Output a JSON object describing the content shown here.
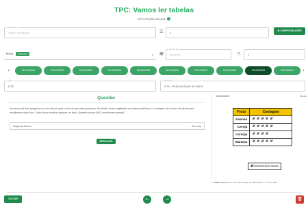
{
  "header": {
    "title": "TPC: Vamos ler tabelas",
    "subheading": "DESCRIÇÃO ALUNA",
    "help_icon": "question-circle-icon"
  },
  "form": {
    "topic_field": {
      "label": "Tópico(s) *",
      "placeholder": "Tópico de tabelas"
    },
    "order_field": {
      "label": "",
      "value": "1"
    },
    "config_button_label": "CONFIGURAÇÕES",
    "tipo_label": "Tema",
    "tipo_tag": "ENTRADA",
    "time_field": {
      "label": "Tempo (s)",
      "value": "00:00:10"
    },
    "sort_field": {
      "label": "",
      "value": "1"
    },
    "code_field": {
      "label": "Cód *",
      "value": "QTE"
    },
    "desc_field": {
      "label": "Descrição",
      "value": "QTE - Representação de dados"
    }
  },
  "pills": [
    {
      "label": "9101000001"
    },
    {
      "label": "9101000002"
    },
    {
      "label": "9101000003"
    },
    {
      "label": "9101000004"
    },
    {
      "label": "9101000005"
    },
    {
      "label": "9101000006"
    },
    {
      "label": "9101000007"
    },
    {
      "label": "9101000008"
    },
    {
      "label": "9101000009"
    },
    {
      "label": "9101000010"
    }
  ],
  "question": {
    "title": "Questão",
    "text": "Na escola da Ana, perguntou-se aos alunos qual o fruto de que mais gostavam. Na tabela, foram registadas as frutas escolhidas e a contagem do número de alunos que escolheram cada fruto. Cada aluno escolheu apenas um fruto. Quantos alunos NÃO escolheram ananás?",
    "answer_type": "Resposta Aberta",
    "answer_right": "Ad.-resp",
    "resolve_label": "RESOLVER"
  },
  "resource": {
    "id": "9101000009",
    "meta": "Media",
    "table": {
      "headers": [
        "Fruto",
        "Contagem"
      ],
      "rows": [
        {
          "fruit": "Ananás",
          "marks": "𝍸 𝍸 𝍸 𝍸 𝍸"
        },
        {
          "fruit": "Cereja",
          "marks": "𝍸 𝍸 𝍸 𝍸 𝍸"
        },
        {
          "fruit": "Laranja",
          "marks": "𝍸 𝍸 𝍸 𝍸"
        },
        {
          "fruit": "Banana",
          "marks": "𝍸 𝍸 𝍸 𝍸 𝍸"
        }
      ]
    },
    "legend_mark": "𝍸",
    "legend_text": "Representa 5 alunos",
    "source_label": "Fonte:",
    "source_text": "Adaptado de Prova de aferição de Matemática - 1.º ciclo, 2014"
  },
  "footer": {
    "back_label": "VOLTAR",
    "prev_icon": "arrow-left-icon",
    "next_icon": "arrow-right-icon",
    "delete_icon": "trash-icon"
  }
}
